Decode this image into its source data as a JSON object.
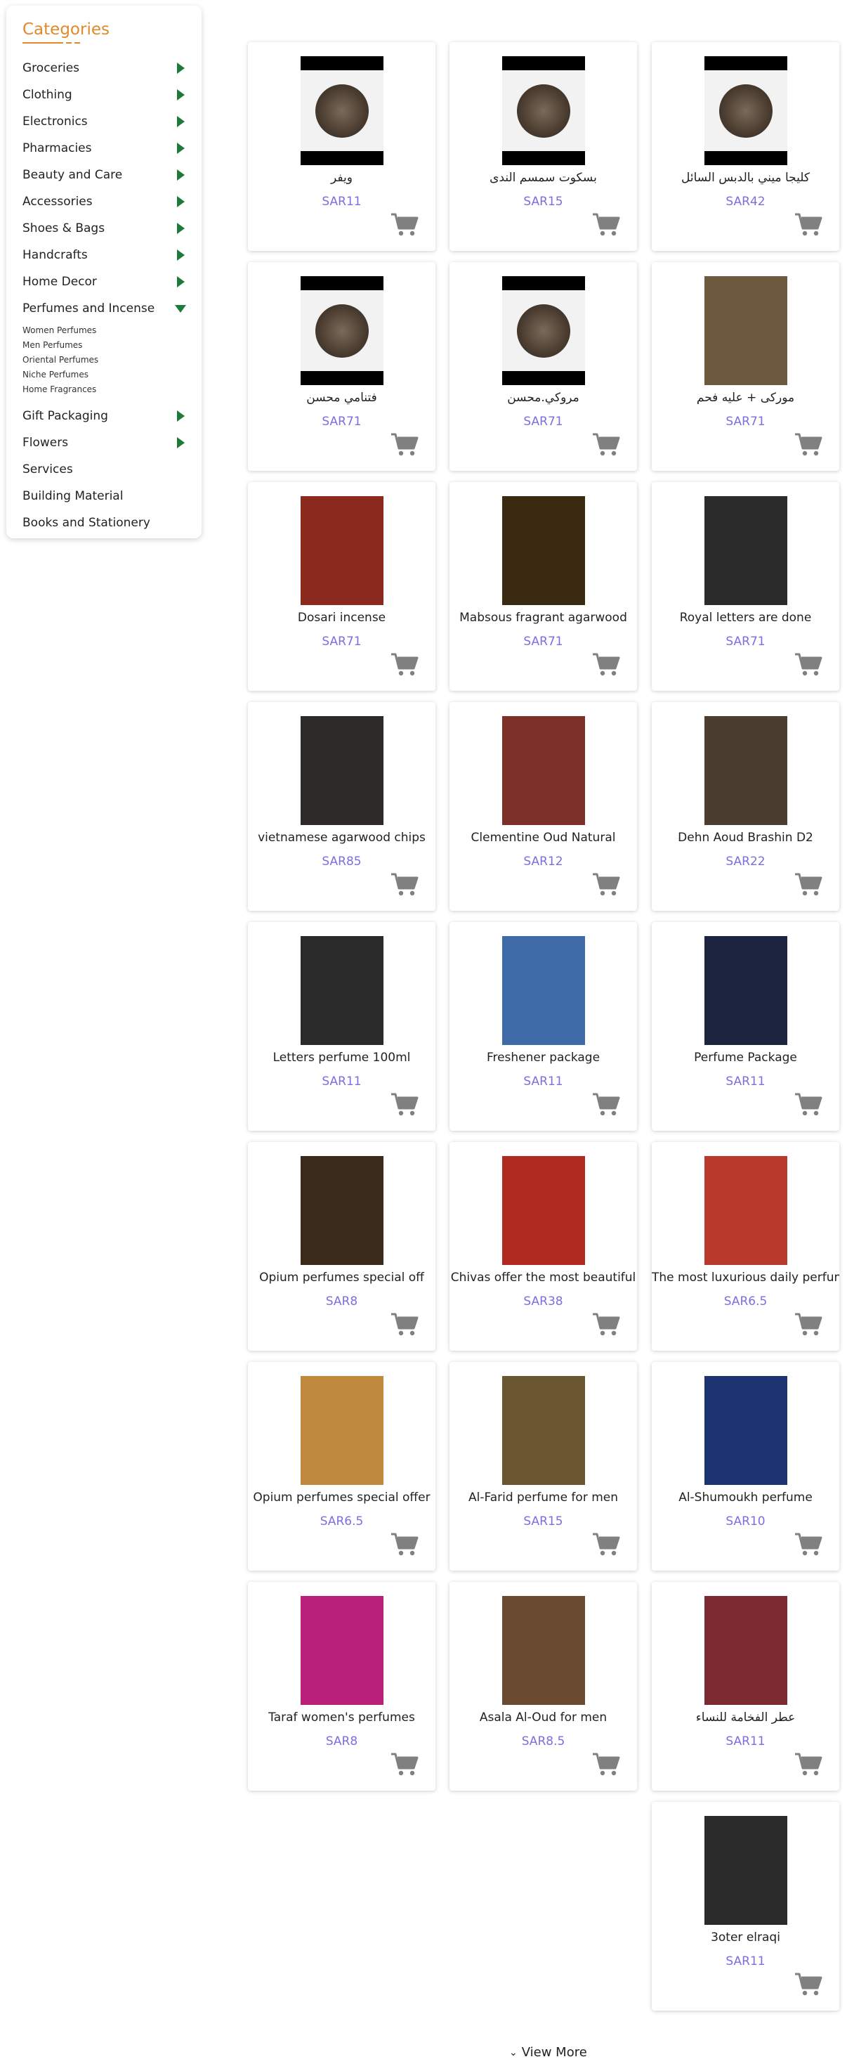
{
  "sidebar": {
    "title": "Categories",
    "categories": [
      {
        "label": "Groceries",
        "arrow": "right"
      },
      {
        "label": "Clothing",
        "arrow": "right"
      },
      {
        "label": "Electronics",
        "arrow": "right"
      },
      {
        "label": "Pharmacies",
        "arrow": "right"
      },
      {
        "label": "Beauty and Care",
        "arrow": "right"
      },
      {
        "label": "Accessories",
        "arrow": "right"
      },
      {
        "label": "Shoes & Bags",
        "arrow": "right"
      },
      {
        "label": "Handcrafts",
        "arrow": "right"
      },
      {
        "label": "Home Decor",
        "arrow": "right"
      },
      {
        "label": "Perfumes and Incense",
        "arrow": "down"
      },
      {
        "label": "Gift Packaging",
        "arrow": "right"
      },
      {
        "label": "Flowers",
        "arrow": "right"
      },
      {
        "label": "Services",
        "arrow": "none"
      },
      {
        "label": "Building Material",
        "arrow": "none"
      },
      {
        "label": "Books and Stationery",
        "arrow": "none"
      }
    ],
    "subcategories": [
      "Women Perfumes",
      "Men Perfumes",
      "Oriental Perfumes",
      "Niche Perfumes",
      "Home Fragrances"
    ]
  },
  "products": [
    {
      "name": "كليجا ميني بالدبس السائل",
      "price": "SAR42",
      "icon": "product-image"
    },
    {
      "name": "بسكوت سمسم الندى",
      "price": "SAR15",
      "icon": "product-image"
    },
    {
      "name": "ويفر",
      "price": "SAR11",
      "icon": "product-image"
    },
    {
      "name": "موركى + عليه فحم",
      "price": "SAR71",
      "icon": "product-image"
    },
    {
      "name": "مروكي.محسن",
      "price": "SAR71",
      "icon": "product-image"
    },
    {
      "name": "فتنامي محسن",
      "price": "SAR71",
      "icon": "product-image"
    },
    {
      "name": "Royal letters are done",
      "price": "SAR71",
      "icon": "product-image"
    },
    {
      "name": "Mabsous fragrant agarwood",
      "price": "SAR71",
      "icon": "product-image"
    },
    {
      "name": "Dosari incense",
      "price": "SAR71",
      "icon": "product-image"
    },
    {
      "name": "Dehn Aoud Brashin D2",
      "price": "SAR22",
      "icon": "product-image"
    },
    {
      "name": "Clementine Oud Natural",
      "price": "SAR12",
      "icon": "product-image"
    },
    {
      "name": "vietnamese agarwood chips",
      "price": "SAR85",
      "icon": "product-image"
    },
    {
      "name": "Perfume Package",
      "price": "SAR11",
      "icon": "product-image"
    },
    {
      "name": "Freshener package",
      "price": "SAR11",
      "icon": "product-image"
    },
    {
      "name": "Letters perfume 100ml",
      "price": "SAR11",
      "icon": "product-image"
    },
    {
      "name": "The most luxurious daily perfum",
      "price": "SAR6.5",
      "icon": "product-image"
    },
    {
      "name": "Chivas offer the most beautiful",
      "price": "SAR38",
      "icon": "product-image"
    },
    {
      "name": "Opium perfumes special off",
      "price": "SAR8",
      "icon": "product-image"
    },
    {
      "name": "Al-Shumoukh perfume",
      "price": "SAR10",
      "icon": "product-image"
    },
    {
      "name": "Al-Farid perfume for men",
      "price": "SAR15",
      "icon": "product-image"
    },
    {
      "name": "Opium perfumes special offer",
      "price": "SAR6.5",
      "icon": "product-image"
    },
    {
      "name": "عطر الفخامة للنساء",
      "price": "SAR11",
      "icon": "product-image"
    },
    {
      "name": "Asala Al-Oud for men",
      "price": "SAR8.5",
      "icon": "product-image"
    },
    {
      "name": "Taraf women's perfumes",
      "price": "SAR8",
      "icon": "product-image"
    },
    {
      "name": "3oter elraqi",
      "price": "SAR11",
      "icon": "product-image"
    }
  ],
  "view_more": "View More",
  "colors": {
    "accent": "#e08a2c",
    "arrow": "#1f7a3a",
    "price": "#7b6fe0",
    "cart": "#808080"
  }
}
